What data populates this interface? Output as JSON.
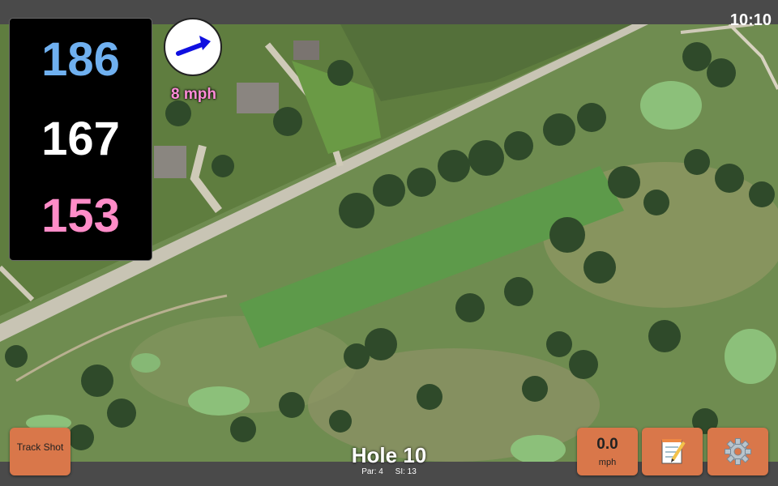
{
  "clock": "10:10",
  "distances": {
    "back": "186",
    "middle": "167",
    "front": "153"
  },
  "wind": {
    "speed": "8 mph",
    "icon": "wind-arrow-icon",
    "direction": "east-northeast"
  },
  "buttons": {
    "track_shot": "Track Shot",
    "speed_value": "0.0",
    "speed_unit": "mph",
    "notes_icon": "notepad-icon",
    "settings_icon": "gear-icon"
  },
  "hole": {
    "title": "Hole 10",
    "par": "Par: 4",
    "si": "SI: 13"
  },
  "colors": {
    "back_distance": "#6fb0f0",
    "middle_distance": "#ffffff",
    "front_distance": "#ff8cc8",
    "button": "#d9774a",
    "wind_text": "#ff8cd8"
  }
}
